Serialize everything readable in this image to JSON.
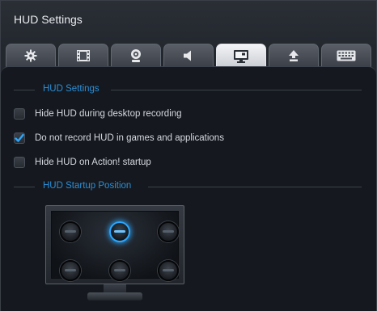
{
  "window": {
    "title": "HUD Settings"
  },
  "tabs": [
    {
      "icon": "gear-icon",
      "active": false
    },
    {
      "icon": "film-icon",
      "active": false
    },
    {
      "icon": "webcam-icon",
      "active": false
    },
    {
      "icon": "speaker-icon",
      "active": false
    },
    {
      "icon": "monitor-icon",
      "active": true
    },
    {
      "icon": "upload-icon",
      "active": false
    },
    {
      "icon": "keyboard-icon",
      "active": false
    }
  ],
  "sections": {
    "hud_settings": {
      "label": "HUD Settings"
    },
    "hud_position": {
      "label": "HUD Startup Position"
    }
  },
  "options": [
    {
      "label": "Hide HUD during desktop recording",
      "checked": false
    },
    {
      "label": "Do not record HUD in games and applications",
      "checked": true
    },
    {
      "label": "Hide HUD on Action! startup",
      "checked": false
    }
  ],
  "position": {
    "rows": 2,
    "cols": 3,
    "selected": "top-center"
  },
  "colors": {
    "accent": "#2b8ed6",
    "check": "#2aa7ff",
    "panel_bg": "#15191f"
  }
}
